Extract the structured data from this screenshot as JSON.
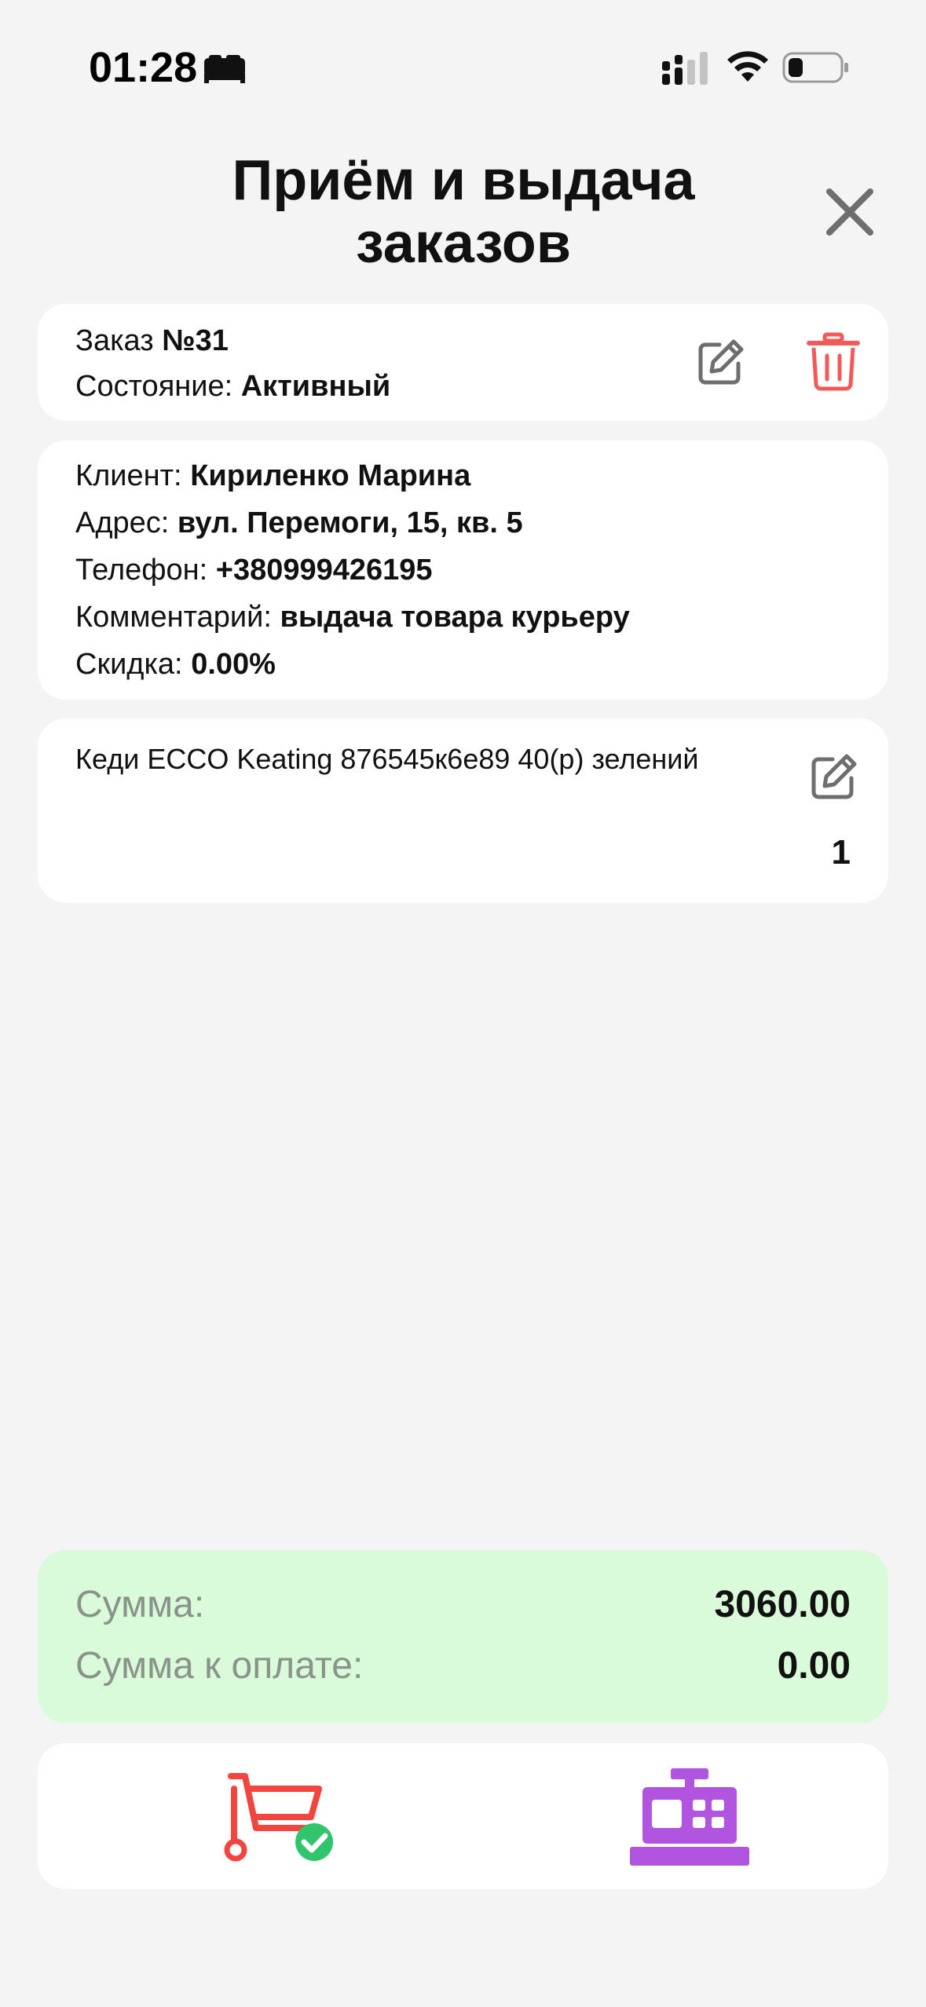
{
  "status_bar": {
    "time": "01:28"
  },
  "header": {
    "title": "Приём и выдача заказов"
  },
  "order": {
    "label": "Заказ ",
    "number": "№31",
    "state_label": "Состояние: ",
    "state_value": "Активный"
  },
  "client": {
    "name_label": "Клиент: ",
    "name_value": "Кириленко Марина",
    "address_label": "Адрес: ",
    "address_value": "вул. Перемоги, 15, кв. 5",
    "phone_label": "Телефон: ",
    "phone_value": "+380999426195",
    "comment_label": "Комментарий: ",
    "comment_value": "выдача товара курьеру",
    "discount_label": "Скидка: ",
    "discount_value": "0.00%"
  },
  "item": {
    "name": "Кеди ECCO Keating 876545к6е89 40(р) зелений",
    "quantity": "1"
  },
  "totals": {
    "sum_label": "Сумма:",
    "sum_value": "3060.00",
    "to_pay_label": "Сумма к оплате:",
    "to_pay_value": "0.00"
  },
  "colors": {
    "background": "#f4f4f4",
    "card": "#ffffff",
    "totals_card": "#dafbd9",
    "delete_red": "#f25a5a",
    "cart_red": "#f2453d",
    "check_green": "#2fc56a",
    "register_purple": "#b154e0",
    "icon_gray": "#6e6e6e"
  },
  "icons": {
    "bed": "bed-icon",
    "signal": "cellular-signal-icon",
    "wifi": "wifi-icon",
    "battery": "battery-icon",
    "close": "close-icon",
    "edit": "edit-icon",
    "delete": "trash-icon",
    "cart": "cart-check-icon",
    "register": "cash-register-icon"
  }
}
